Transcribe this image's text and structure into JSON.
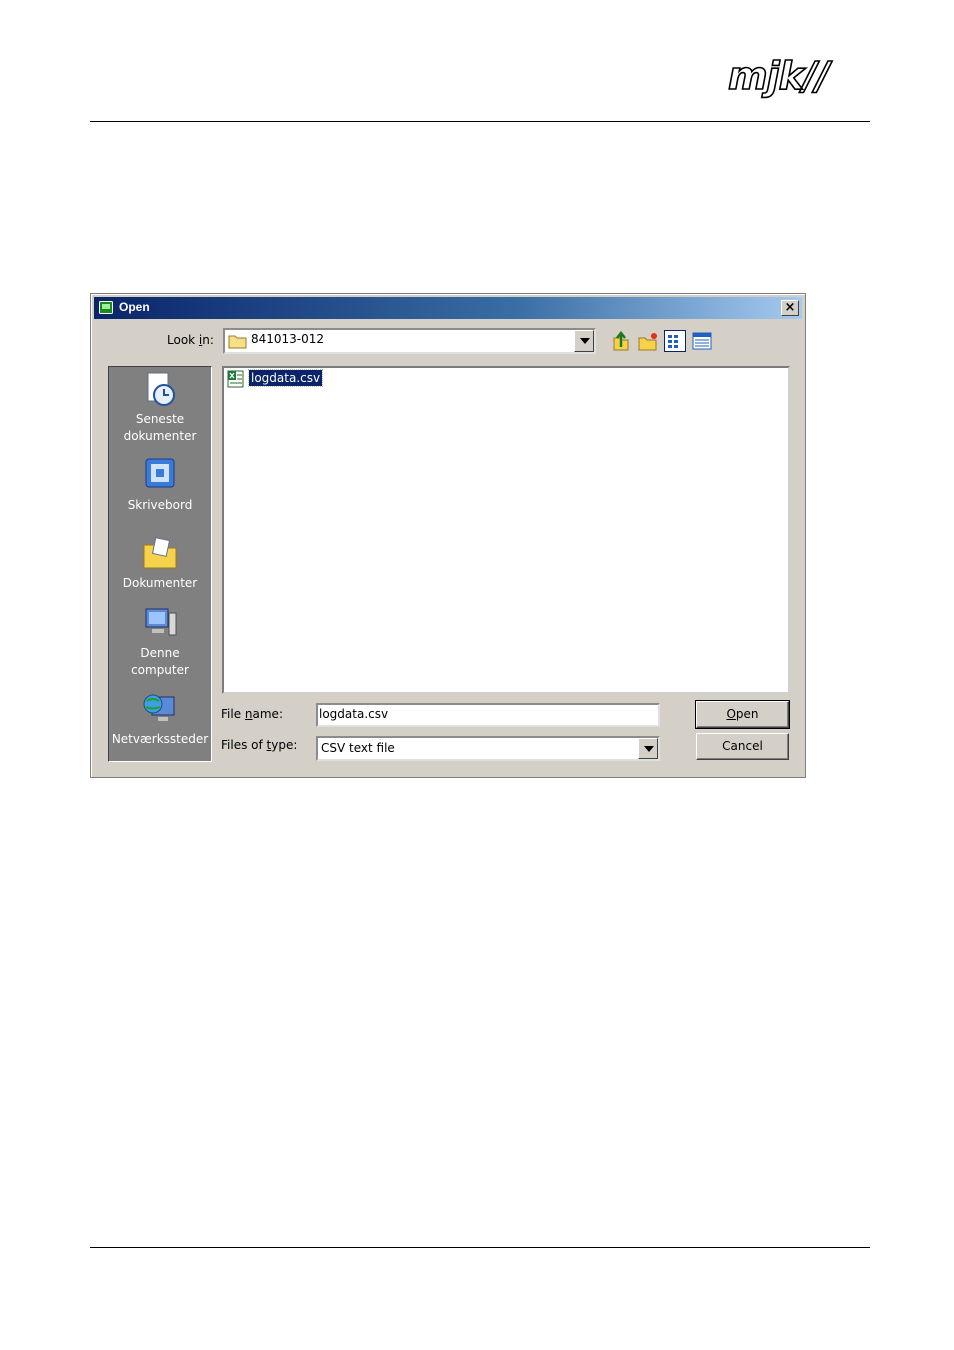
{
  "logo": {
    "text": "mjk//"
  },
  "dialog": {
    "title": "Open",
    "close_glyph": "×",
    "look_in": {
      "label_pre": "Look ",
      "label_u": "i",
      "label_post": "n:",
      "value": "841013-012",
      "icon": "folder-icon"
    },
    "toolbar": [
      {
        "name": "up-one-level-icon"
      },
      {
        "name": "create-new-folder-icon"
      },
      {
        "name": "list-view-icon"
      },
      {
        "name": "details-view-icon"
      }
    ],
    "places": [
      {
        "line1": "Seneste",
        "line2": "dokumenter",
        "icon": "recent-documents-icon"
      },
      {
        "line1": "Skrivebord",
        "line2": "",
        "icon": "desktop-icon"
      },
      {
        "line1": "Dokumenter",
        "line2": "",
        "icon": "my-documents-icon"
      },
      {
        "line1": "Denne",
        "line2": "computer",
        "icon": "my-computer-icon"
      },
      {
        "line1": "Netværkssteder",
        "line2": "",
        "icon": "network-places-icon"
      }
    ],
    "files": [
      {
        "name": "logdata.csv",
        "icon": "csv-file-icon",
        "selected": true
      }
    ],
    "file_name": {
      "label_pre": "File ",
      "label_u": "n",
      "label_post": "ame:",
      "value": "logdata.csv"
    },
    "files_of_type": {
      "label_pre": "Files of ",
      "label_u": "t",
      "label_post": "ype:",
      "value": "CSV text file"
    },
    "open_button": {
      "u": "O",
      "rest": "pen"
    },
    "cancel_button": "Cancel"
  }
}
